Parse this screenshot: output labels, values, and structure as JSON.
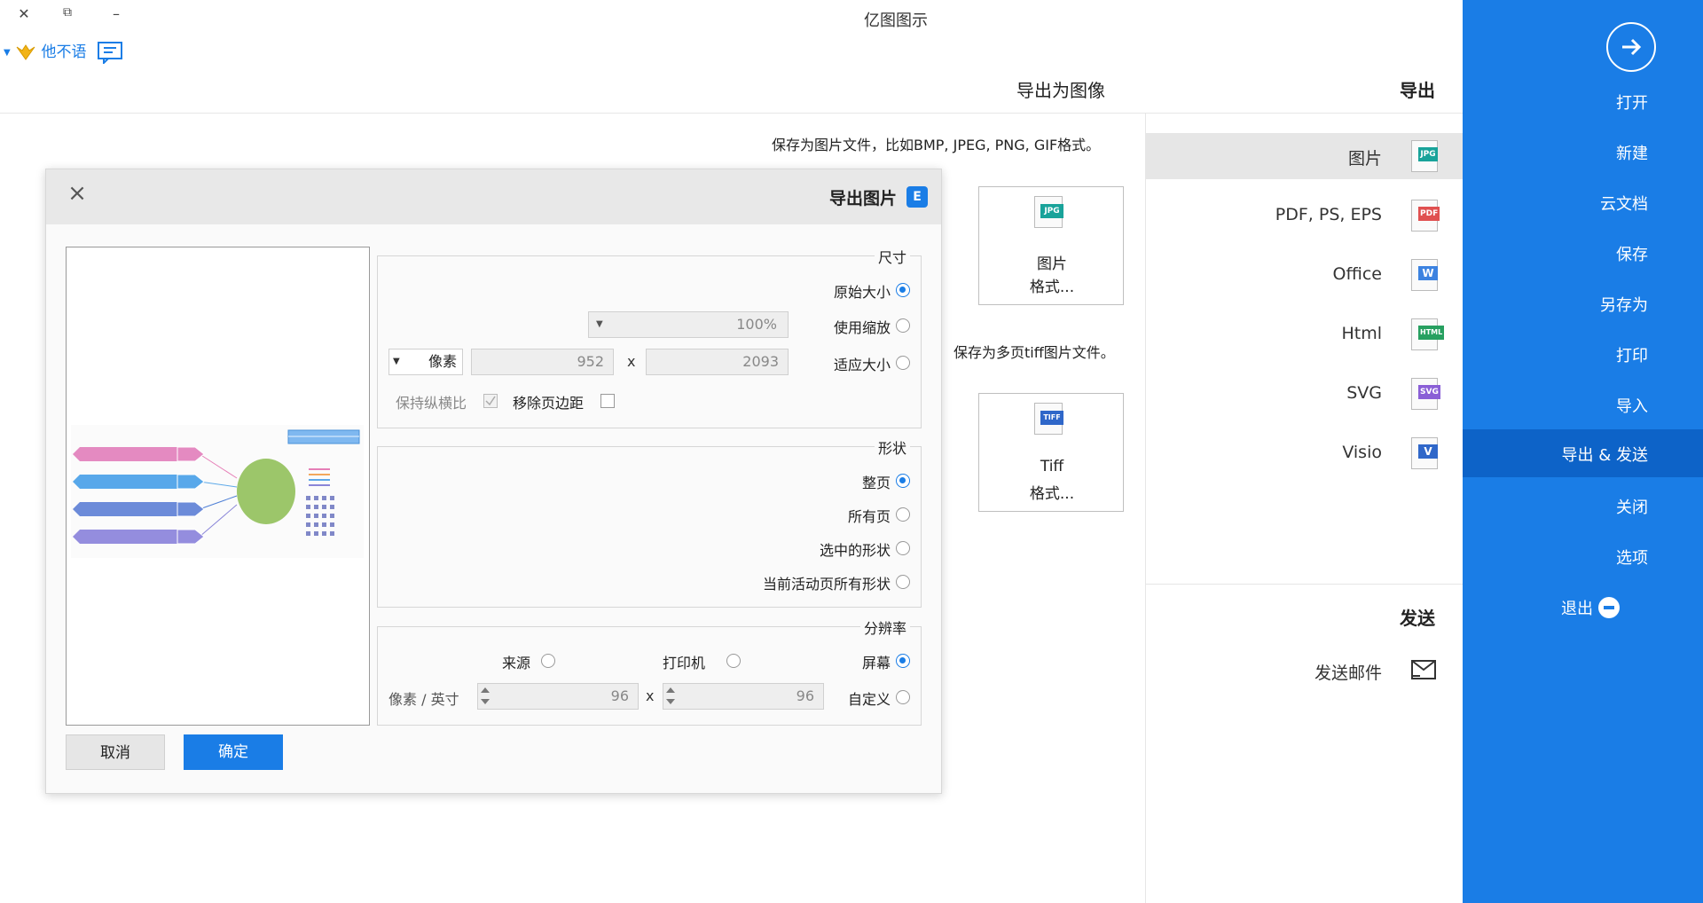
{
  "window": {
    "title": "亿图图示",
    "close": "✕",
    "restore": "⧉",
    "minimize": "–"
  },
  "user": {
    "name": "他不语"
  },
  "sidebar": {
    "items": [
      {
        "label": "打开",
        "active": false
      },
      {
        "label": "新建",
        "active": false
      },
      {
        "label": "云文档",
        "active": false
      },
      {
        "label": "保存",
        "active": false
      },
      {
        "label": "另存为",
        "active": false
      },
      {
        "label": "打印",
        "active": false
      },
      {
        "label": "导入",
        "active": false
      },
      {
        "label": "导出 & 发送",
        "active": true
      },
      {
        "label": "关闭",
        "active": false
      },
      {
        "label": "选项",
        "active": false
      },
      {
        "label": "退出",
        "active": false
      }
    ]
  },
  "export_panel": {
    "title": "导出",
    "items": [
      {
        "label": "图片",
        "tag": "JPG",
        "color": "#19a39a",
        "selected": true
      },
      {
        "label": "PDF, PS, EPS",
        "tag": "PDF",
        "color": "#e05050",
        "selected": false
      },
      {
        "label": "Office",
        "tag": "W",
        "color": "#3c82e0",
        "selected": false
      },
      {
        "label": "Html",
        "tag": "HTML",
        "color": "#27a060",
        "selected": false
      },
      {
        "label": "SVG",
        "tag": "SVG",
        "color": "#8a5fd6",
        "selected": false
      },
      {
        "label": "Visio",
        "tag": "V",
        "color": "#2f67c9",
        "selected": false
      }
    ],
    "send_title": "发送",
    "send_item": "发送邮件"
  },
  "main": {
    "title": "导出为图像",
    "desc1": "保存为图片文件，比如BMP, JPEG, PNG, GIF格式。",
    "card1": {
      "tag": "JPG",
      "line1": "图片",
      "line2": "格式..."
    },
    "desc2": "保存为多页tiff图片文件。",
    "card2": {
      "tag": "TIFF",
      "line1": "Tiff",
      "line2": "格式..."
    }
  },
  "dialog": {
    "title": "导出图片",
    "logo": "E",
    "size": {
      "legend": "尺寸",
      "original": "原始大小",
      "zoom": "使用缩放",
      "zoom_value": "100%",
      "fit": "适应大小",
      "width": "2093",
      "height": "952",
      "unit": "像素",
      "x": "x",
      "remove_margin": "移除页边距",
      "keep_ratio": "保持纵横比"
    },
    "shape": {
      "legend": "形状",
      "options": [
        "整页",
        "所有页",
        "选中的形状",
        "当前活动页所有形状"
      ]
    },
    "resolution": {
      "legend": "分辨率",
      "screen": "屏幕",
      "printer": "打印机",
      "source": "来源",
      "custom": "自定义",
      "dpi_x": "96",
      "dpi_y": "96",
      "unit": "像素 / 英寸",
      "x": "x"
    },
    "ok": "确定",
    "cancel": "取消"
  }
}
